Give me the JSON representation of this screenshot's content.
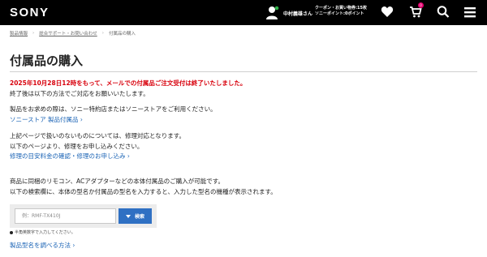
{
  "header": {
    "logo": "SONY",
    "user_name": "中村義雄さん",
    "coupon_line1": "クーポン・お買い物券:15枚",
    "coupon_line2": "ソニーポイント:0ポイント",
    "cart_count": "0",
    "icons": [
      "user-icon",
      "heart-icon",
      "cart-icon",
      "search-icon",
      "menu-icon"
    ]
  },
  "breadcrumb": {
    "items": [
      "製品情報",
      "総合サポート・お問い合わせ",
      "付属品の購入"
    ]
  },
  "page": {
    "title": "付属品の購入",
    "alert": "2025年10月28日12時をもって、メールでの付属品ご注文受付は終了いたしました。",
    "line1": "終了後は以下の方法でご対応をお願いいたします。",
    "line2": "製品をお求めの際は、ソニー特約店またはソニーストアをご利用ください。",
    "link1": "ソニーストア 製品付属品",
    "line3": "上記ページで扱いのないものについては、修理対応となります。",
    "line4": "以下のページより、修理をお申し込みください。",
    "link2": "修理の目安料金の確認・修理のお申し込み",
    "line5": "商品に同梱のリモコン、ACアダプターなどの本体付属品のご購入が可能です。",
    "line6": "以下の検索欄に、本体の型名か付属品の型名を入力すると、入力した型名の機種が表示されます。",
    "link3": "製品型名を調べる方法"
  },
  "search": {
    "placeholder": "例：RMF-TX410J",
    "button_label": "検索",
    "note": "半角英数字で入力してください。"
  },
  "colors": {
    "header_bg": "#000000",
    "alert": "#d8000c",
    "link": "#1a63b5",
    "button": "#2f70c3",
    "online_dot": "#2fb24a",
    "badge": "#e4006f"
  }
}
